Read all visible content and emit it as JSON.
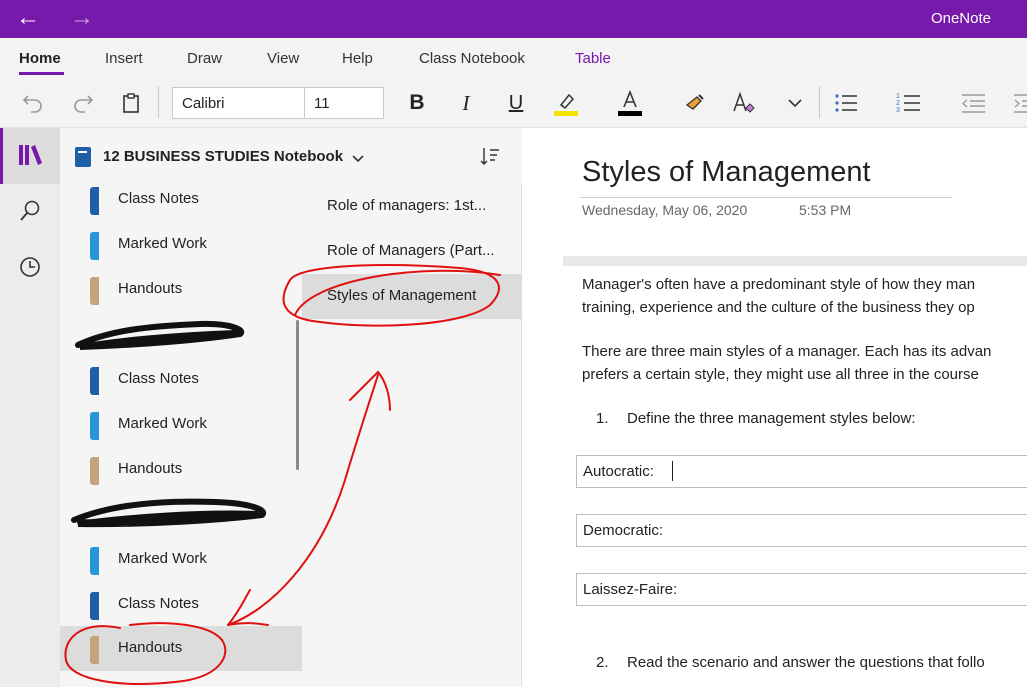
{
  "app": {
    "title": "OneNote"
  },
  "ribbon": {
    "tabs": [
      {
        "label": "Home"
      },
      {
        "label": "Insert"
      },
      {
        "label": "Draw"
      },
      {
        "label": "View"
      },
      {
        "label": "Help"
      },
      {
        "label": "Class Notebook"
      },
      {
        "label": "Table"
      }
    ],
    "font_name": "Calibri",
    "font_size": "11",
    "highlight_color": "#f2e600",
    "font_color": "#000000"
  },
  "notebook": {
    "name": "12 BUSINESS STUDIES Notebook",
    "sections": [
      {
        "label": "Class Notes",
        "color": "#1e5fa8"
      },
      {
        "label": "Marked Work",
        "color": "#2796d6"
      },
      {
        "label": "Handouts",
        "color": "#c4a47c"
      },
      {
        "label": "Class Notes",
        "color": "#1e5fa8"
      },
      {
        "label": "Marked Work",
        "color": "#2796d6"
      },
      {
        "label": "Handouts",
        "color": "#c4a47c"
      },
      {
        "label": "Marked Work",
        "color": "#2796d6"
      },
      {
        "label": "Class Notes",
        "color": "#1e5fa8"
      },
      {
        "label": "Handouts",
        "color": "#c4a47c"
      }
    ]
  },
  "pages": [
    {
      "label": "Role of managers: 1st..."
    },
    {
      "label": "Role of Managers (Part..."
    },
    {
      "label": "Styles of Management"
    }
  ],
  "page": {
    "title": "Styles of Management",
    "date": "Wednesday, May 06, 2020",
    "time": "5:53 PM",
    "para1_line1": "Manager's often have a predominant style of how they man",
    "para1_line2": "training, experience and the culture of the business they op",
    "para2_line1": "There are three main styles of a manager. Each has its advan",
    "para2_line2": "prefers a certain style, they might use all three in the course",
    "item1_num": "1.",
    "item1_text": "Define the three management styles below:",
    "styles": [
      "Autocratic:",
      "Democratic:",
      "Laissez-Faire:"
    ],
    "item2_num": "2.",
    "item2_text": "Read the scenario and answer the questions that follo"
  },
  "colors": {
    "accent": "#7719aa",
    "annotation": "#e01010"
  }
}
